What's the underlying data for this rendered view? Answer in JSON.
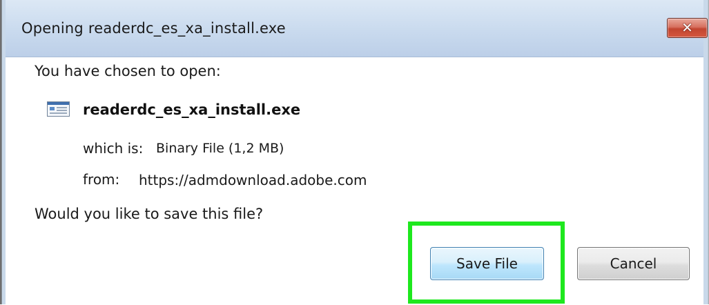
{
  "window": {
    "title": "Opening readerdc_es_xa_install.exe",
    "close_icon": "close-icon"
  },
  "dialog": {
    "prompt": "You have chosen to open:",
    "file_icon": "executable-file-icon",
    "file_name": "readerdc_es_xa_install.exe",
    "which_is_label": "which is:",
    "which_is_value": "Binary File (1,2 MB)",
    "from_label": "from:",
    "from_value": "https://admdownload.adobe.com",
    "question": "Would you like to save this file?"
  },
  "buttons": {
    "save_label": "Save File",
    "cancel_label": "Cancel"
  },
  "colors": {
    "highlight": "#1ee81e",
    "close_button": "#c24530",
    "title_bar": "#c9daee"
  }
}
